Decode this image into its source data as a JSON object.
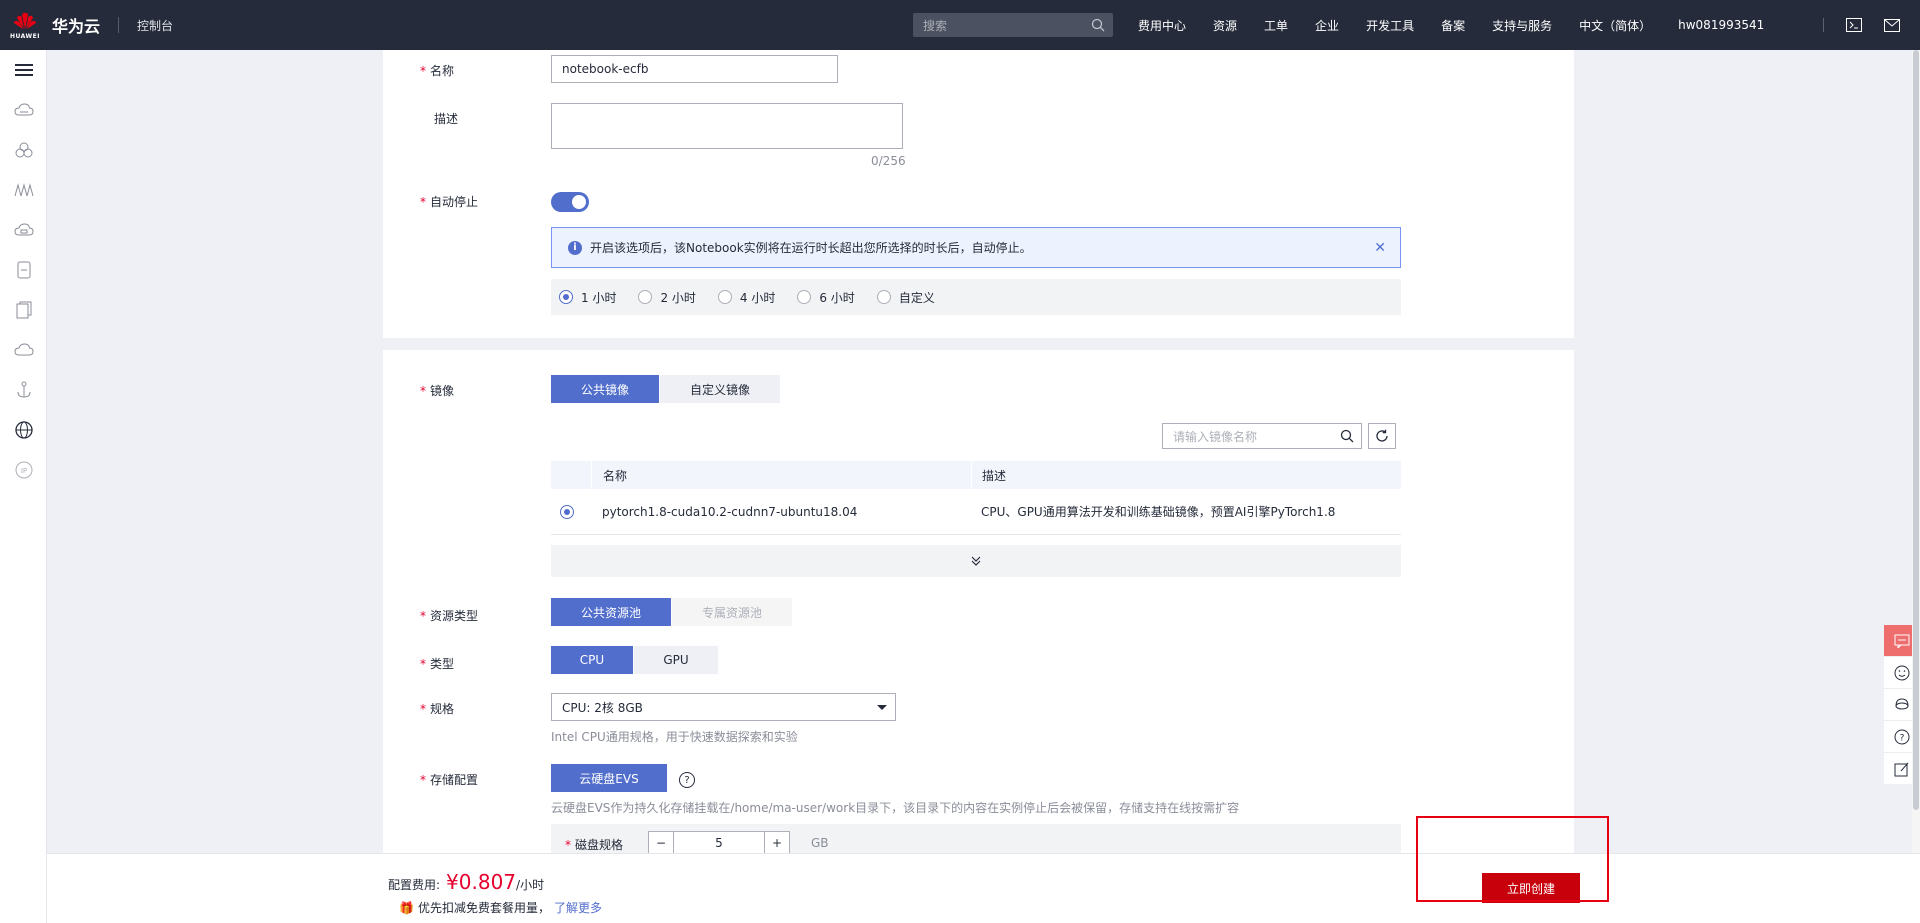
{
  "header": {
    "brand": "华为云",
    "logo_text": "HUAWEI",
    "console": "控制台",
    "search_placeholder": "搜索",
    "nav": [
      "费用中心",
      "资源",
      "工单",
      "企业",
      "开发工具",
      "备案",
      "支持与服务",
      "中文（简体）"
    ],
    "user": "hw081993541"
  },
  "sidebar": {
    "icons": [
      "menu-icon",
      "cloud-server-icon",
      "cluster-icon",
      "modelarts-icon",
      "cloud-storage-icon",
      "database-icon",
      "document-icon",
      "cloud-icon",
      "anchor-icon",
      "globe-icon",
      "ip-icon"
    ]
  },
  "form": {
    "name_label": "名称",
    "name_value": "notebook-ecfb",
    "desc_label": "描述",
    "desc_counter": "0/256",
    "auto_stop_label": "自动停止",
    "auto_stop_on": true,
    "info_text": "开启该选项后，该Notebook实例将在运行时长超出您所选择的时长后，自动停止。",
    "durations": [
      "1 小时",
      "2 小时",
      "4 小时",
      "6 小时",
      "自定义"
    ],
    "duration_selected": "1 小时",
    "image_label": "镜像",
    "image_tabs": [
      "公共镜像",
      "自定义镜像"
    ],
    "image_search_placeholder": "请输入镜像名称",
    "table_headers": [
      "名称",
      "描述"
    ],
    "table_rows": [
      {
        "name": "pytorch1.8-cuda10.2-cudnn7-ubuntu18.04",
        "desc": "CPU、GPU通用算法开发和训练基础镜像，预置AI引擎PyTorch1.8"
      }
    ],
    "pool_label": "资源类型",
    "pool_options": [
      "公共资源池",
      "专属资源池"
    ],
    "type_label": "类型",
    "type_options": [
      "CPU",
      "GPU"
    ],
    "spec_label": "规格",
    "spec_value": "CPU: 2核 8GB",
    "spec_hint": "Intel CPU通用规格，用于快速数据探索和实验",
    "storage_label": "存储配置",
    "storage_option": "云硬盘EVS",
    "storage_help": "?",
    "storage_hint": "云硬盘EVS作为持久化存储挂载在/home/ma-user/work目录下，该目录下的内容在实例停止后会被保留，存储支持在线按需扩容",
    "disk_label": "磁盘规格",
    "disk_value": "5",
    "disk_unit": "GB"
  },
  "footer": {
    "price_label": "配置费用:",
    "price": "¥0.807",
    "per": "/小时",
    "promo": "优先扣减免费套餐用量，",
    "more_link": "了解更多",
    "create_button": "立即创建"
  },
  "colors": {
    "accent": "#526ecc",
    "danger": "#c7000b",
    "topbar": "#252b3a"
  }
}
